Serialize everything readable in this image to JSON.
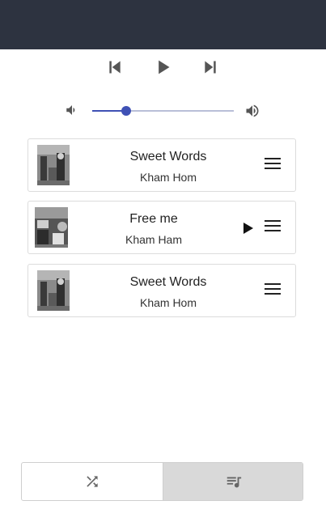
{
  "header": {
    "background": "#2d3340"
  },
  "transport": {
    "previous_icon": "skip-previous-icon",
    "play_icon": "play-icon",
    "next_icon": "skip-next-icon"
  },
  "volume": {
    "mute_icon": "volume-low-icon",
    "max_icon": "volume-high-icon",
    "level": 0.24,
    "accent": "#3f51b5"
  },
  "playlist": [
    {
      "title": "Sweet Words",
      "artist": "Kham Hom",
      "art": "album-art-sweet-words",
      "playing": false
    },
    {
      "title": "Free me",
      "artist": "Kham Ham",
      "art": "album-art-free-me",
      "playing": true
    },
    {
      "title": "Sweet Words",
      "artist": "Kham Hom",
      "art": "album-art-sweet-words",
      "playing": false
    }
  ],
  "modes": {
    "shuffle_icon": "shuffle-icon",
    "queue_icon": "playlist-queue-icon",
    "active": "queue",
    "active_bg": "#d9d9d9"
  }
}
